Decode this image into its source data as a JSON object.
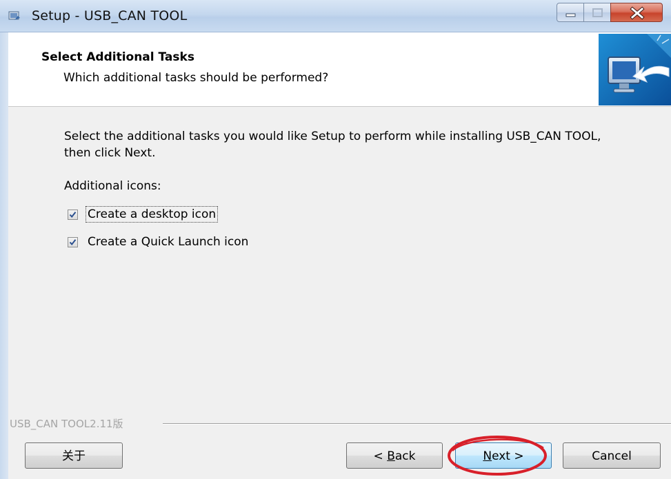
{
  "window": {
    "title": "Setup - USB_CAN TOOL"
  },
  "header": {
    "title": "Select Additional Tasks",
    "subtitle": "Which additional tasks should be performed?"
  },
  "body": {
    "instructions": "Select the additional tasks you would like Setup to perform while installing USB_CAN TOOL, then click Next.",
    "section_label": "Additional icons:",
    "tasks": [
      {
        "label": "Create a desktop icon",
        "checked": true
      },
      {
        "label": "Create a Quick Launch icon",
        "checked": true
      }
    ]
  },
  "footer": {
    "version": "USB_CAN TOOL2.11版"
  },
  "buttons": {
    "about": "关于",
    "back_prefix": "< ",
    "back_accel": "B",
    "back_rest": "ack",
    "next_accel": "N",
    "next_rest": "ext >",
    "cancel": "Cancel"
  },
  "colors": {
    "highlight_ring": "#d8202a",
    "next_button_border": "#3c7fb1"
  },
  "icons": {
    "app": "installer-app-icon",
    "wizard": "computer-install-arrow-icon",
    "minimize": "minimize-icon",
    "maximize": "maximize-icon",
    "close": "close-icon",
    "check": "checkmark-icon"
  }
}
